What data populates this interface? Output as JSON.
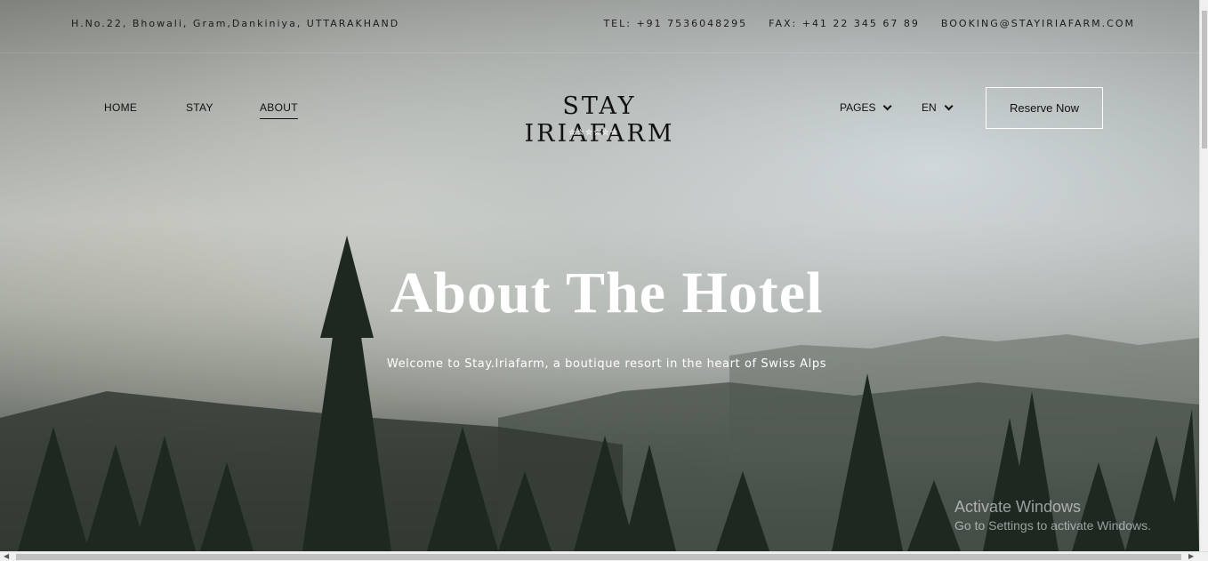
{
  "topbar": {
    "address": "H.No.22, Bhowali, Gram,Dankiniya, UTTARAKHAND",
    "tel": "TEL: +91 7536048295",
    "fax": "FAX: +41 22 345 67 89",
    "email": "BOOKING@STAYIRIAFARM.COM"
  },
  "nav": {
    "home": "HOME",
    "stay": "STAY",
    "about": "ABOUT",
    "pages": "PAGES",
    "lang": "EN",
    "reserve": "Reserve Now"
  },
  "brand": {
    "name": "STAY IRIAFARM",
    "stars": "✮✮✮✮✮✮"
  },
  "hero": {
    "title": "About The Hotel",
    "subtitle": "Welcome to Stay.Iriafarm, a boutique resort in the heart of Swiss Alps"
  },
  "watermark": {
    "line1": "Activate Windows",
    "line2": "Go to Settings to activate Windows."
  },
  "colors": {
    "text_dark": "#111111",
    "hero_text": "#ffffff"
  }
}
